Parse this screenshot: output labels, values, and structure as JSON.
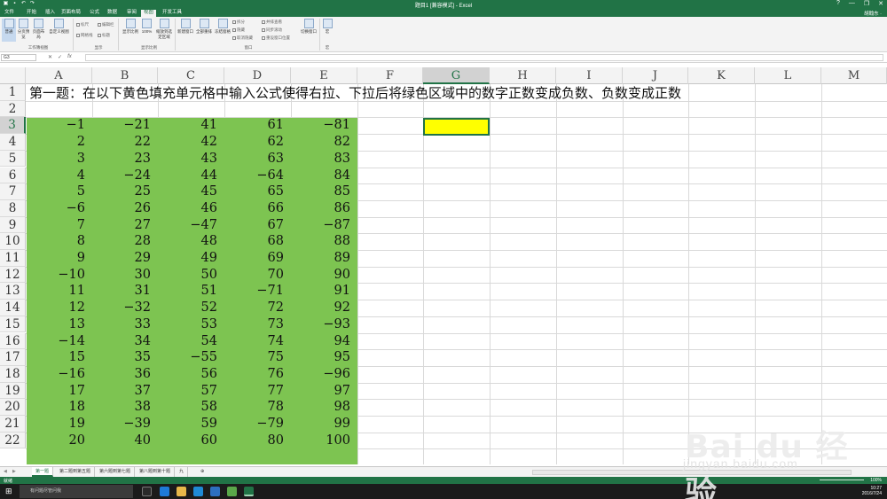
{
  "window": {
    "title": "题目1 [兼容模式] - Excel",
    "controls": [
      "?",
      "—",
      "❐",
      "✕"
    ]
  },
  "ribbon": {
    "tabs": [
      {
        "label": "文件",
        "active": false
      },
      {
        "label": "开始",
        "active": false
      },
      {
        "label": "插入",
        "active": false
      },
      {
        "label": "页面布局",
        "active": false
      },
      {
        "label": "公式",
        "active": false
      },
      {
        "label": "数据",
        "active": false
      },
      {
        "label": "审阅",
        "active": false
      },
      {
        "label": "视图",
        "active": true
      },
      {
        "label": "开发工具",
        "active": false
      }
    ],
    "user": "胡翰东 ·",
    "buttons": {
      "normal": "普通",
      "page_break": "分页预览",
      "page_layout": "页面布局",
      "custom_views": "自定义视图",
      "zoom": "显示比例",
      "zoom100": "100%",
      "zoom_selection": "缩放到选定区域",
      "new_window": "新建窗口",
      "arrange_all": "全部重排",
      "freeze": "冻结窗格",
      "switch_windows": "切换窗口",
      "macros": "宏"
    },
    "checkboxes": {
      "ruler": "标尺",
      "gridlines": "网格线",
      "formula_bar": "编辑栏",
      "headings": "标题"
    },
    "window_small": [
      "拆分",
      "隐藏",
      "取消隐藏"
    ],
    "window_small2": [
      "并排查看",
      "同步滚动",
      "重设窗口位置"
    ],
    "groups": {
      "workbook_views": "工作簿视图",
      "show": "显示",
      "zoom": "显示比例",
      "window": "窗口",
      "macros": "宏"
    }
  },
  "formula_bar": {
    "name_box": "G3",
    "fx": "fx",
    "value": ""
  },
  "sheet": {
    "columns": [
      "A",
      "B",
      "C",
      "D",
      "E",
      "F",
      "G",
      "H",
      "I",
      "J",
      "K",
      "L",
      "M"
    ],
    "selected_column": "G",
    "rows": [
      "1",
      "2",
      "3",
      "4",
      "5",
      "6",
      "7",
      "8",
      "9",
      "10",
      "11",
      "12",
      "13",
      "14",
      "15",
      "16",
      "17",
      "18",
      "19",
      "20",
      "21",
      "22"
    ],
    "selected_row": "3",
    "row1_text": "第一题：在以下黄色填充单元格中输入公式使得右拉、下拉后将绿色区域中的数字正数变成负数、负数变成正数",
    "green_fill": "#7dc451",
    "yellow_fill": "#ffff00",
    "data": [
      [
        "−1",
        "−21",
        "41",
        "61",
        "−81"
      ],
      [
        "2",
        "22",
        "42",
        "62",
        "82"
      ],
      [
        "3",
        "23",
        "43",
        "63",
        "83"
      ],
      [
        "4",
        "−24",
        "44",
        "−64",
        "84"
      ],
      [
        "5",
        "25",
        "45",
        "65",
        "85"
      ],
      [
        "−6",
        "26",
        "46",
        "66",
        "86"
      ],
      [
        "7",
        "27",
        "−47",
        "67",
        "−87"
      ],
      [
        "8",
        "28",
        "48",
        "68",
        "88"
      ],
      [
        "9",
        "29",
        "49",
        "69",
        "89"
      ],
      [
        "−10",
        "30",
        "50",
        "70",
        "90"
      ],
      [
        "11",
        "31",
        "51",
        "−71",
        "91"
      ],
      [
        "12",
        "−32",
        "52",
        "72",
        "92"
      ],
      [
        "13",
        "33",
        "53",
        "73",
        "−93"
      ],
      [
        "−14",
        "34",
        "54",
        "74",
        "94"
      ],
      [
        "15",
        "35",
        "−55",
        "75",
        "95"
      ],
      [
        "−16",
        "36",
        "56",
        "76",
        "−96"
      ],
      [
        "17",
        "37",
        "57",
        "77",
        "97"
      ],
      [
        "18",
        "38",
        "58",
        "78",
        "98"
      ],
      [
        "19",
        "−39",
        "59",
        "−79",
        "99"
      ],
      [
        "20",
        "40",
        "60",
        "80",
        "100"
      ]
    ]
  },
  "sheet_tabs": [
    {
      "label": "第一题",
      "active": true
    },
    {
      "label": "第二题到第五题",
      "active": false
    },
    {
      "label": "第六题到第七题",
      "active": false
    },
    {
      "label": "第八题到第十题",
      "active": false
    },
    {
      "label": "九",
      "active": false
    },
    {
      "label": "⊕",
      "active": false
    }
  ],
  "status": {
    "ready": "就绪",
    "zoom": "100%"
  },
  "taskbar": {
    "search_placeholder": "有问题尽管问我",
    "time": "10:27",
    "date": "2016/7/24",
    "ime": "中"
  },
  "watermark": {
    "brand": "Bai du 经验",
    "url": "jingyan.baidu.com"
  }
}
